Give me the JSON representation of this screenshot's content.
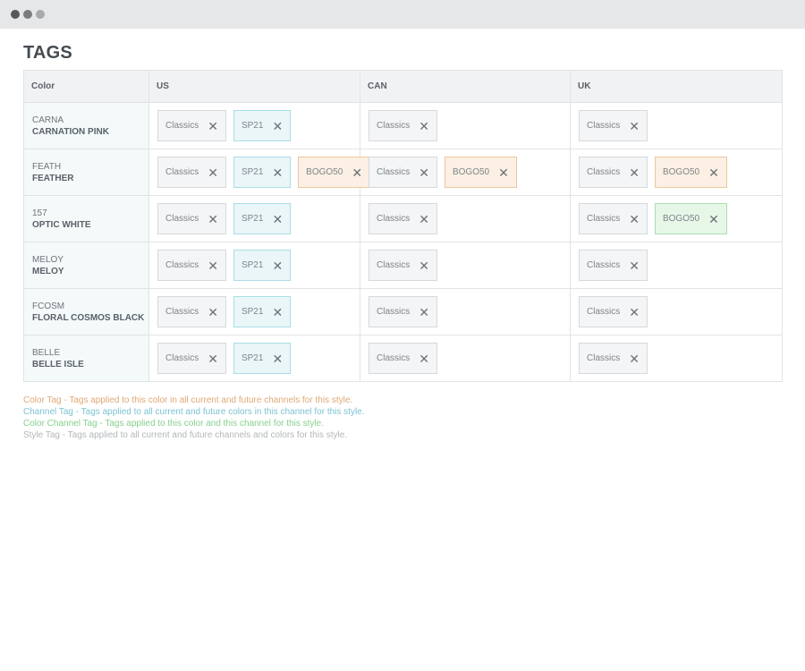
{
  "window": {
    "dot_colors": [
      "#56595c",
      "#7a7d80",
      "#a7aaad"
    ]
  },
  "page_title": "TAGS",
  "table": {
    "headers": [
      "Color",
      "US",
      "CAN",
      "UK"
    ],
    "rows": [
      {
        "code": "CARNA",
        "name": "CARNATION PINK",
        "us": [
          {
            "label": "Classics",
            "type": "style"
          },
          {
            "label": "SP21",
            "type": "channel"
          }
        ],
        "can": [
          {
            "label": "Classics",
            "type": "style"
          }
        ],
        "uk": [
          {
            "label": "Classics",
            "type": "style"
          }
        ]
      },
      {
        "code": "FEATH",
        "name": "FEATHER",
        "us": [
          {
            "label": "Classics",
            "type": "style"
          },
          {
            "label": "SP21",
            "type": "channel"
          },
          {
            "label": "BOGO50",
            "type": "color"
          }
        ],
        "can": [
          {
            "label": "Classics",
            "type": "style"
          },
          {
            "label": "BOGO50",
            "type": "color"
          }
        ],
        "uk": [
          {
            "label": "Classics",
            "type": "style"
          },
          {
            "label": "BOGO50",
            "type": "color"
          }
        ]
      },
      {
        "code": "157",
        "name": "OPTIC WHITE",
        "us": [
          {
            "label": "Classics",
            "type": "style"
          },
          {
            "label": "SP21",
            "type": "channel"
          }
        ],
        "can": [
          {
            "label": "Classics",
            "type": "style"
          }
        ],
        "uk": [
          {
            "label": "Classics",
            "type": "style"
          },
          {
            "label": "BOGO50",
            "type": "colorchannel"
          }
        ]
      },
      {
        "code": "MELOY",
        "name": "MELOY",
        "us": [
          {
            "label": "Classics",
            "type": "style"
          },
          {
            "label": "SP21",
            "type": "channel"
          }
        ],
        "can": [
          {
            "label": "Classics",
            "type": "style"
          }
        ],
        "uk": [
          {
            "label": "Classics",
            "type": "style"
          }
        ]
      },
      {
        "code": "FCOSM",
        "name": "FLORAL COSMOS BLACK",
        "us": [
          {
            "label": "Classics",
            "type": "style"
          },
          {
            "label": "SP21",
            "type": "channel"
          }
        ],
        "can": [
          {
            "label": "Classics",
            "type": "style"
          }
        ],
        "uk": [
          {
            "label": "Classics",
            "type": "style"
          }
        ]
      },
      {
        "code": "BELLE",
        "name": "BELLE ISLE",
        "us": [
          {
            "label": "Classics",
            "type": "style"
          },
          {
            "label": "SP21",
            "type": "channel"
          }
        ],
        "can": [
          {
            "label": "Classics",
            "type": "style"
          }
        ],
        "uk": [
          {
            "label": "Classics",
            "type": "style"
          }
        ]
      }
    ],
    "remove_glyph": "✕"
  },
  "legend": [
    {
      "text": "Color Tag - Tags applied to this color in all current and future channels for this style.",
      "color": "#e0a876"
    },
    {
      "text": "Channel Tag - Tags applied to all current and future colors in this channel for this style.",
      "color": "#7cc3d3"
    },
    {
      "text": "Color Channel Tag - Tags applied to this color and this channel for this style.",
      "color": "#86d08e"
    },
    {
      "text": "Style Tag - Tags applied to all current and future channels and colors for this style.",
      "color": "#b3b7ba"
    }
  ]
}
